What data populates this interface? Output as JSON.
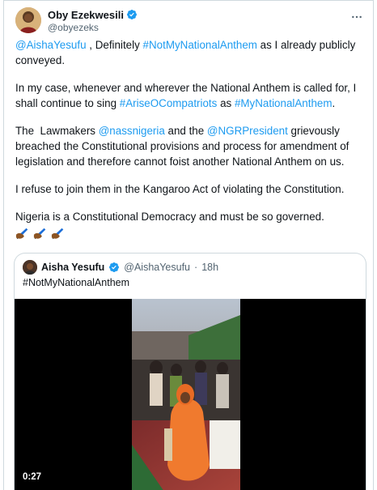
{
  "tweet": {
    "author_name": "Oby Ezekwesili",
    "author_handle": "@obyezeks",
    "avatar_icon": "profile-photo",
    "verified_icon": "verified-badge-icon",
    "more_icon": "more-options-icon",
    "paragraph1": {
      "mention": "@AishaYesufu",
      "text_a": " , Definitely ",
      "hashtag": "#NotMyNationalAnthem",
      "text_b": " as I already publicly conveyed."
    },
    "paragraph2": {
      "text_a": "In my case, whenever and wherever the National Anthem is called for, I shall continue to sing ",
      "hashtag1": "#AriseOCompatriots",
      "text_b": " as ",
      "hashtag2": "#MyNationalAnthem",
      "text_c": "."
    },
    "paragraph3": {
      "text_a": "The  Lawmakers ",
      "mention1": "@nassnigeria",
      "text_b": " and the ",
      "mention2": "@NGRPresident",
      "text_c": " grievously breached the Constitutional provisions and process for amendment of legislation and therefore cannot foist another National Anthem on us."
    },
    "paragraph4": "I refuse to join them in the Kangaroo Act of violating the Constitution.",
    "paragraph5": "Nigeria is a Constitutional Democracy and must be so governed.",
    "emoji_icons": [
      "writing-hand-emoji",
      "writing-hand-emoji",
      "writing-hand-emoji"
    ],
    "link_color": "#1d9bf0"
  },
  "quoted_tweet": {
    "author_name": "Aisha Yesufu",
    "author_handle": "@AishaYesufu",
    "separator": "·",
    "time_ago": "18h",
    "text": "#NotMyNationalAnthem",
    "video_duration": "0:27"
  }
}
